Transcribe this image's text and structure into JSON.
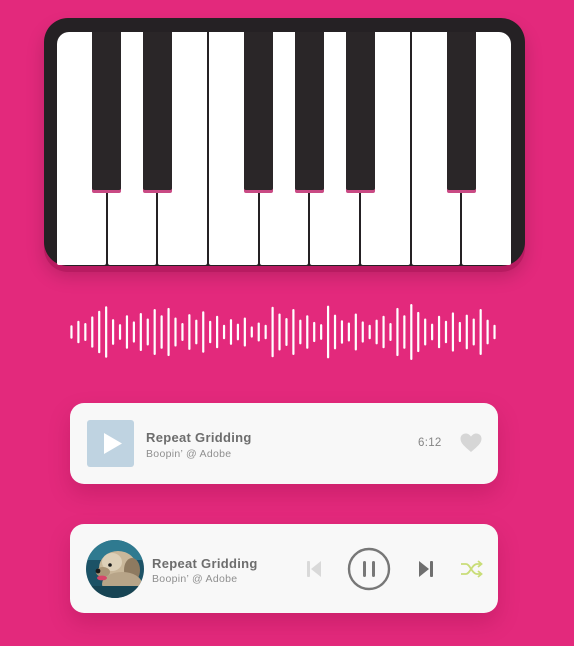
{
  "piano": {
    "white_key_count": 9,
    "black_key_count": 6
  },
  "waveform": {
    "bar_heights": [
      0.24,
      0.4,
      0.32,
      0.56,
      0.76,
      0.92,
      0.46,
      0.28,
      0.6,
      0.38,
      0.68,
      0.48,
      0.82,
      0.6,
      0.86,
      0.52,
      0.32,
      0.64,
      0.44,
      0.74,
      0.4,
      0.58,
      0.26,
      0.46,
      0.3,
      0.52,
      0.2,
      0.34,
      0.26,
      0.9,
      0.66,
      0.5,
      0.82,
      0.44,
      0.6,
      0.36,
      0.28,
      0.94,
      0.62,
      0.42,
      0.34,
      0.66,
      0.38,
      0.26,
      0.44,
      0.58,
      0.32,
      0.86,
      0.6,
      1.0,
      0.72,
      0.48,
      0.3,
      0.58,
      0.4,
      0.7,
      0.36,
      0.62,
      0.48,
      0.82,
      0.44,
      0.26
    ],
    "color": "#ffffff"
  },
  "colors": {
    "background": "#e3297c",
    "card": "#f8f8f8",
    "piano_frame": "#252124",
    "shuffle_accent": "#c9dd78",
    "play_thumb": "#bfd3e1"
  },
  "track_card": {
    "title": "Repeat Gridding",
    "subtitle": "Boopin’ @ Adobe",
    "duration": "6:12",
    "play_icon": "play-icon",
    "like_icon": "heart-icon"
  },
  "player_card": {
    "title": "Repeat Gridding",
    "subtitle": "Boopin’ @ Adobe",
    "avatar_icon": "dog-avatar",
    "controls": [
      "skip-back-icon",
      "pause-icon",
      "skip-forward-icon",
      "shuffle-icon"
    ]
  }
}
